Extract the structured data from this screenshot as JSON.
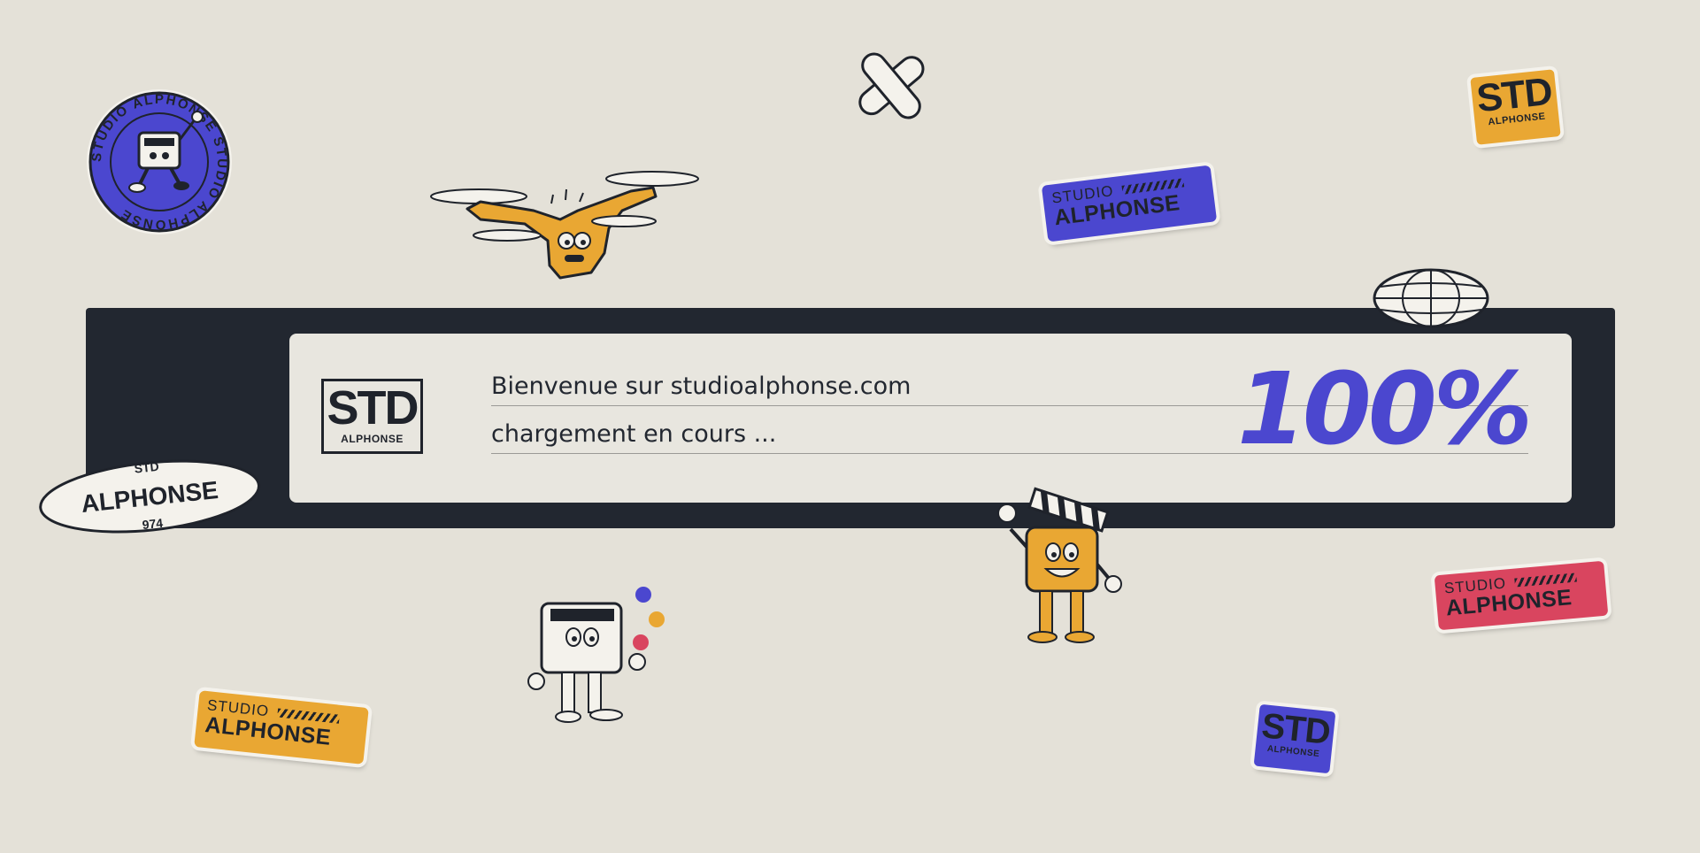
{
  "colors": {
    "background": "#e4e1d8",
    "dark": "#222730",
    "card": "#e8e6df",
    "blue": "#4b47cf",
    "orange": "#e9a733",
    "red": "#d9455f"
  },
  "loader": {
    "logo_big": "STD",
    "logo_small": "ALPHONSE",
    "line1": "Bienvenue sur studioalphonse.com",
    "line2": "chargement en cours ...",
    "progress": "100%",
    "progress_value": 1.0
  },
  "stickers": {
    "round_badge_text": "STUDIO ALPHONSE STUDIO ALPHONSE",
    "oval_top": "STD",
    "oval_main": "ALPHONSE",
    "oval_bottom": "974",
    "studio_label": "STUDIO",
    "alphonse_label": "ALPHONSE",
    "std_big": "STD",
    "std_small": "ALPHONSE"
  },
  "icons": [
    "bandage-icon",
    "globe-icon",
    "drone-mascot",
    "computer-mascot",
    "clapperboard-mascot"
  ]
}
